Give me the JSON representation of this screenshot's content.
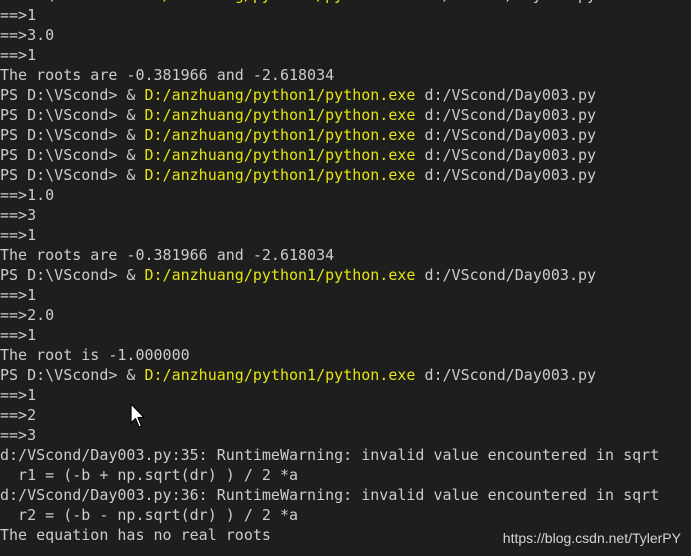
{
  "terminal": {
    "lines": [
      {
        "segments": [
          {
            "text": "PS D:\\VScond> & "
          },
          {
            "text": "D:/anzhuang/python1/python.exe",
            "color": "yellow"
          },
          {
            "text": " d:/VScond/Day003.py"
          }
        ]
      },
      {
        "segments": [
          {
            "text": "==>1"
          }
        ]
      },
      {
        "segments": [
          {
            "text": "==>3.0"
          }
        ]
      },
      {
        "segments": [
          {
            "text": "==>1"
          }
        ]
      },
      {
        "segments": [
          {
            "text": "The roots are -0.381966 and -2.618034"
          }
        ]
      },
      {
        "segments": [
          {
            "text": "PS D:\\VScond> & "
          },
          {
            "text": "D:/anzhuang/python1/python.exe",
            "color": "yellow"
          },
          {
            "text": " d:/VScond/Day003.py"
          }
        ]
      },
      {
        "segments": [
          {
            "text": "PS D:\\VScond> & "
          },
          {
            "text": "D:/anzhuang/python1/python.exe",
            "color": "yellow"
          },
          {
            "text": " d:/VScond/Day003.py"
          }
        ]
      },
      {
        "segments": [
          {
            "text": "PS D:\\VScond> & "
          },
          {
            "text": "D:/anzhuang/python1/python.exe",
            "color": "yellow"
          },
          {
            "text": " d:/VScond/Day003.py"
          }
        ]
      },
      {
        "segments": [
          {
            "text": "PS D:\\VScond> & "
          },
          {
            "text": "D:/anzhuang/python1/python.exe",
            "color": "yellow"
          },
          {
            "text": " d:/VScond/Day003.py"
          }
        ]
      },
      {
        "segments": [
          {
            "text": "PS D:\\VScond> & "
          },
          {
            "text": "D:/anzhuang/python1/python.exe",
            "color": "yellow"
          },
          {
            "text": " d:/VScond/Day003.py"
          }
        ]
      },
      {
        "segments": [
          {
            "text": "==>1.0"
          }
        ]
      },
      {
        "segments": [
          {
            "text": "==>3"
          }
        ]
      },
      {
        "segments": [
          {
            "text": "==>1"
          }
        ]
      },
      {
        "segments": [
          {
            "text": "The roots are -0.381966 and -2.618034"
          }
        ]
      },
      {
        "segments": [
          {
            "text": "PS D:\\VScond> & "
          },
          {
            "text": "D:/anzhuang/python1/python.exe",
            "color": "yellow"
          },
          {
            "text": " d:/VScond/Day003.py"
          }
        ]
      },
      {
        "segments": [
          {
            "text": "==>1"
          }
        ]
      },
      {
        "segments": [
          {
            "text": "==>2.0"
          }
        ]
      },
      {
        "segments": [
          {
            "text": "==>1"
          }
        ]
      },
      {
        "segments": [
          {
            "text": "The root is -1.000000"
          }
        ]
      },
      {
        "segments": [
          {
            "text": "PS D:\\VScond> & "
          },
          {
            "text": "D:/anzhuang/python1/python.exe",
            "color": "yellow"
          },
          {
            "text": " d:/VScond/Day003.py"
          }
        ]
      },
      {
        "segments": [
          {
            "text": "==>1"
          }
        ]
      },
      {
        "segments": [
          {
            "text": "==>2"
          }
        ]
      },
      {
        "segments": [
          {
            "text": "==>3"
          }
        ]
      },
      {
        "segments": [
          {
            "text": "d:/VScond/Day003.py:35: RuntimeWarning: invalid value encountered in sqrt"
          }
        ]
      },
      {
        "segments": [
          {
            "text": "  r1 = (-b + np.sqrt(dr) ) / 2 *a"
          }
        ]
      },
      {
        "segments": [
          {
            "text": "d:/VScond/Day003.py:36: RuntimeWarning: invalid value encountered in sqrt"
          }
        ]
      },
      {
        "segments": [
          {
            "text": "  r2 = (-b - np.sqrt(dr) ) / 2 *a"
          }
        ]
      },
      {
        "segments": [
          {
            "text": "The equation has no real roots"
          }
        ]
      }
    ]
  },
  "watermark": "https://blog.csdn.net/TylerPY",
  "colors": {
    "background": "#1e1e1e",
    "text": "#cccccc",
    "yellow": "#e5e510"
  }
}
